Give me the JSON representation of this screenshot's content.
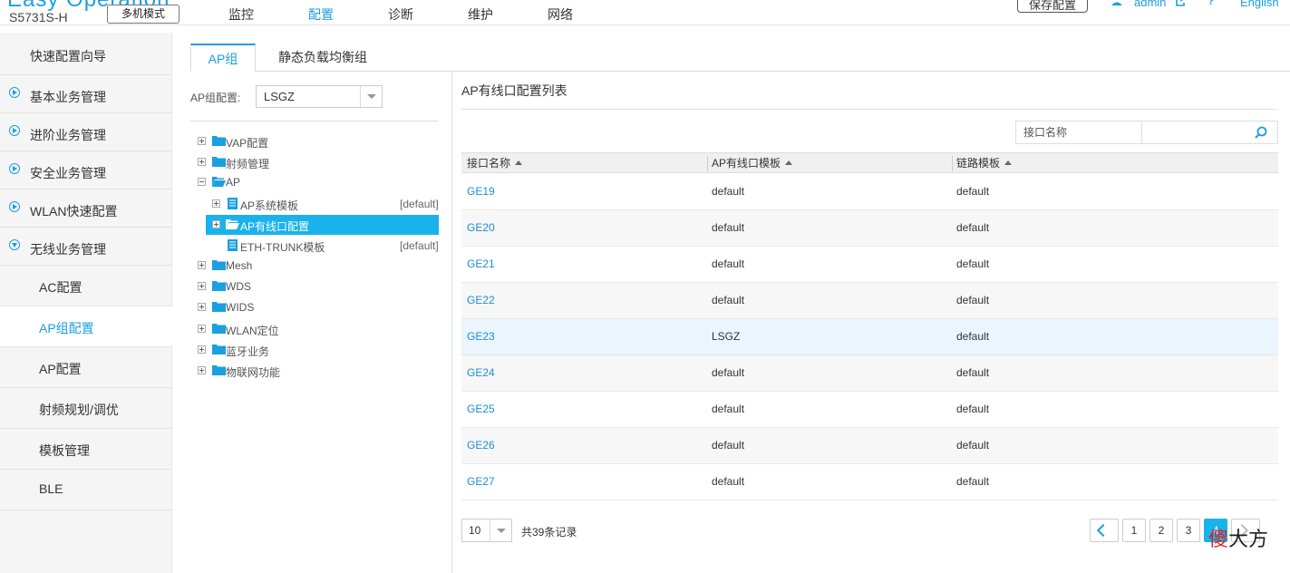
{
  "header": {
    "brand": "Easy Operation",
    "model": "S5731S-H",
    "mode_button": "多机模式",
    "nav": [
      "监控",
      "配置",
      "诊断",
      "维护",
      "网络"
    ],
    "active_nav": "配置",
    "save_button": "保存配置",
    "user": "admin",
    "help": "?",
    "language": "English"
  },
  "sidebar": {
    "top_items": [
      "快速配置向导",
      "基本业务管理",
      "进阶业务管理",
      "安全业务管理",
      "WLAN快速配置",
      "无线业务管理"
    ],
    "sub_items": [
      "AC配置",
      "AP组配置",
      "AP配置",
      "射频规划/调优",
      "模板管理",
      "BLE"
    ],
    "active_sub": "AP组配置"
  },
  "tabs": [
    "AP组",
    "静态负载均衡组"
  ],
  "ap_group": {
    "label": "AP组配置:",
    "selected": "LSGZ"
  },
  "tree": {
    "nodes": [
      {
        "label": "VAP配置"
      },
      {
        "label": "射频管理"
      },
      {
        "label": "AP"
      },
      {
        "label": "AP系统模板",
        "tag": "[default]"
      },
      {
        "label": "AP有线口配置"
      },
      {
        "label": "ETH-TRUNK模板",
        "tag": "[default]"
      },
      {
        "label": "Mesh"
      },
      {
        "label": "WDS"
      },
      {
        "label": "WIDS"
      },
      {
        "label": "WLAN定位"
      },
      {
        "label": "蓝牙业务"
      },
      {
        "label": "物联网功能"
      }
    ]
  },
  "panel": {
    "title": "AP有线口配置列表",
    "search_label": "接口名称",
    "search_placeholder": "",
    "columns": [
      "接口名称",
      "AP有线口模板",
      "链路模板"
    ],
    "rows": [
      [
        "GE19",
        "default",
        "default"
      ],
      [
        "GE20",
        "default",
        "default"
      ],
      [
        "GE21",
        "default",
        "default"
      ],
      [
        "GE22",
        "default",
        "default"
      ],
      [
        "GE23",
        "LSGZ",
        "default"
      ],
      [
        "GE24",
        "default",
        "default"
      ],
      [
        "GE25",
        "default",
        "default"
      ],
      [
        "GE26",
        "default",
        "default"
      ],
      [
        "GE27",
        "default",
        "default"
      ]
    ]
  },
  "pagination": {
    "page_size": "10",
    "total_text": "共39条记录",
    "pages": [
      "1",
      "2",
      "3",
      "4"
    ],
    "current_page": "4"
  },
  "watermark": {
    "red_text": "傻",
    "text": "大方"
  },
  "colors": {
    "accent": "#1a9fe0",
    "selected_bg": "#1ab2eb",
    "link": "#1a8fd6",
    "folder": "#1a9fe0"
  }
}
